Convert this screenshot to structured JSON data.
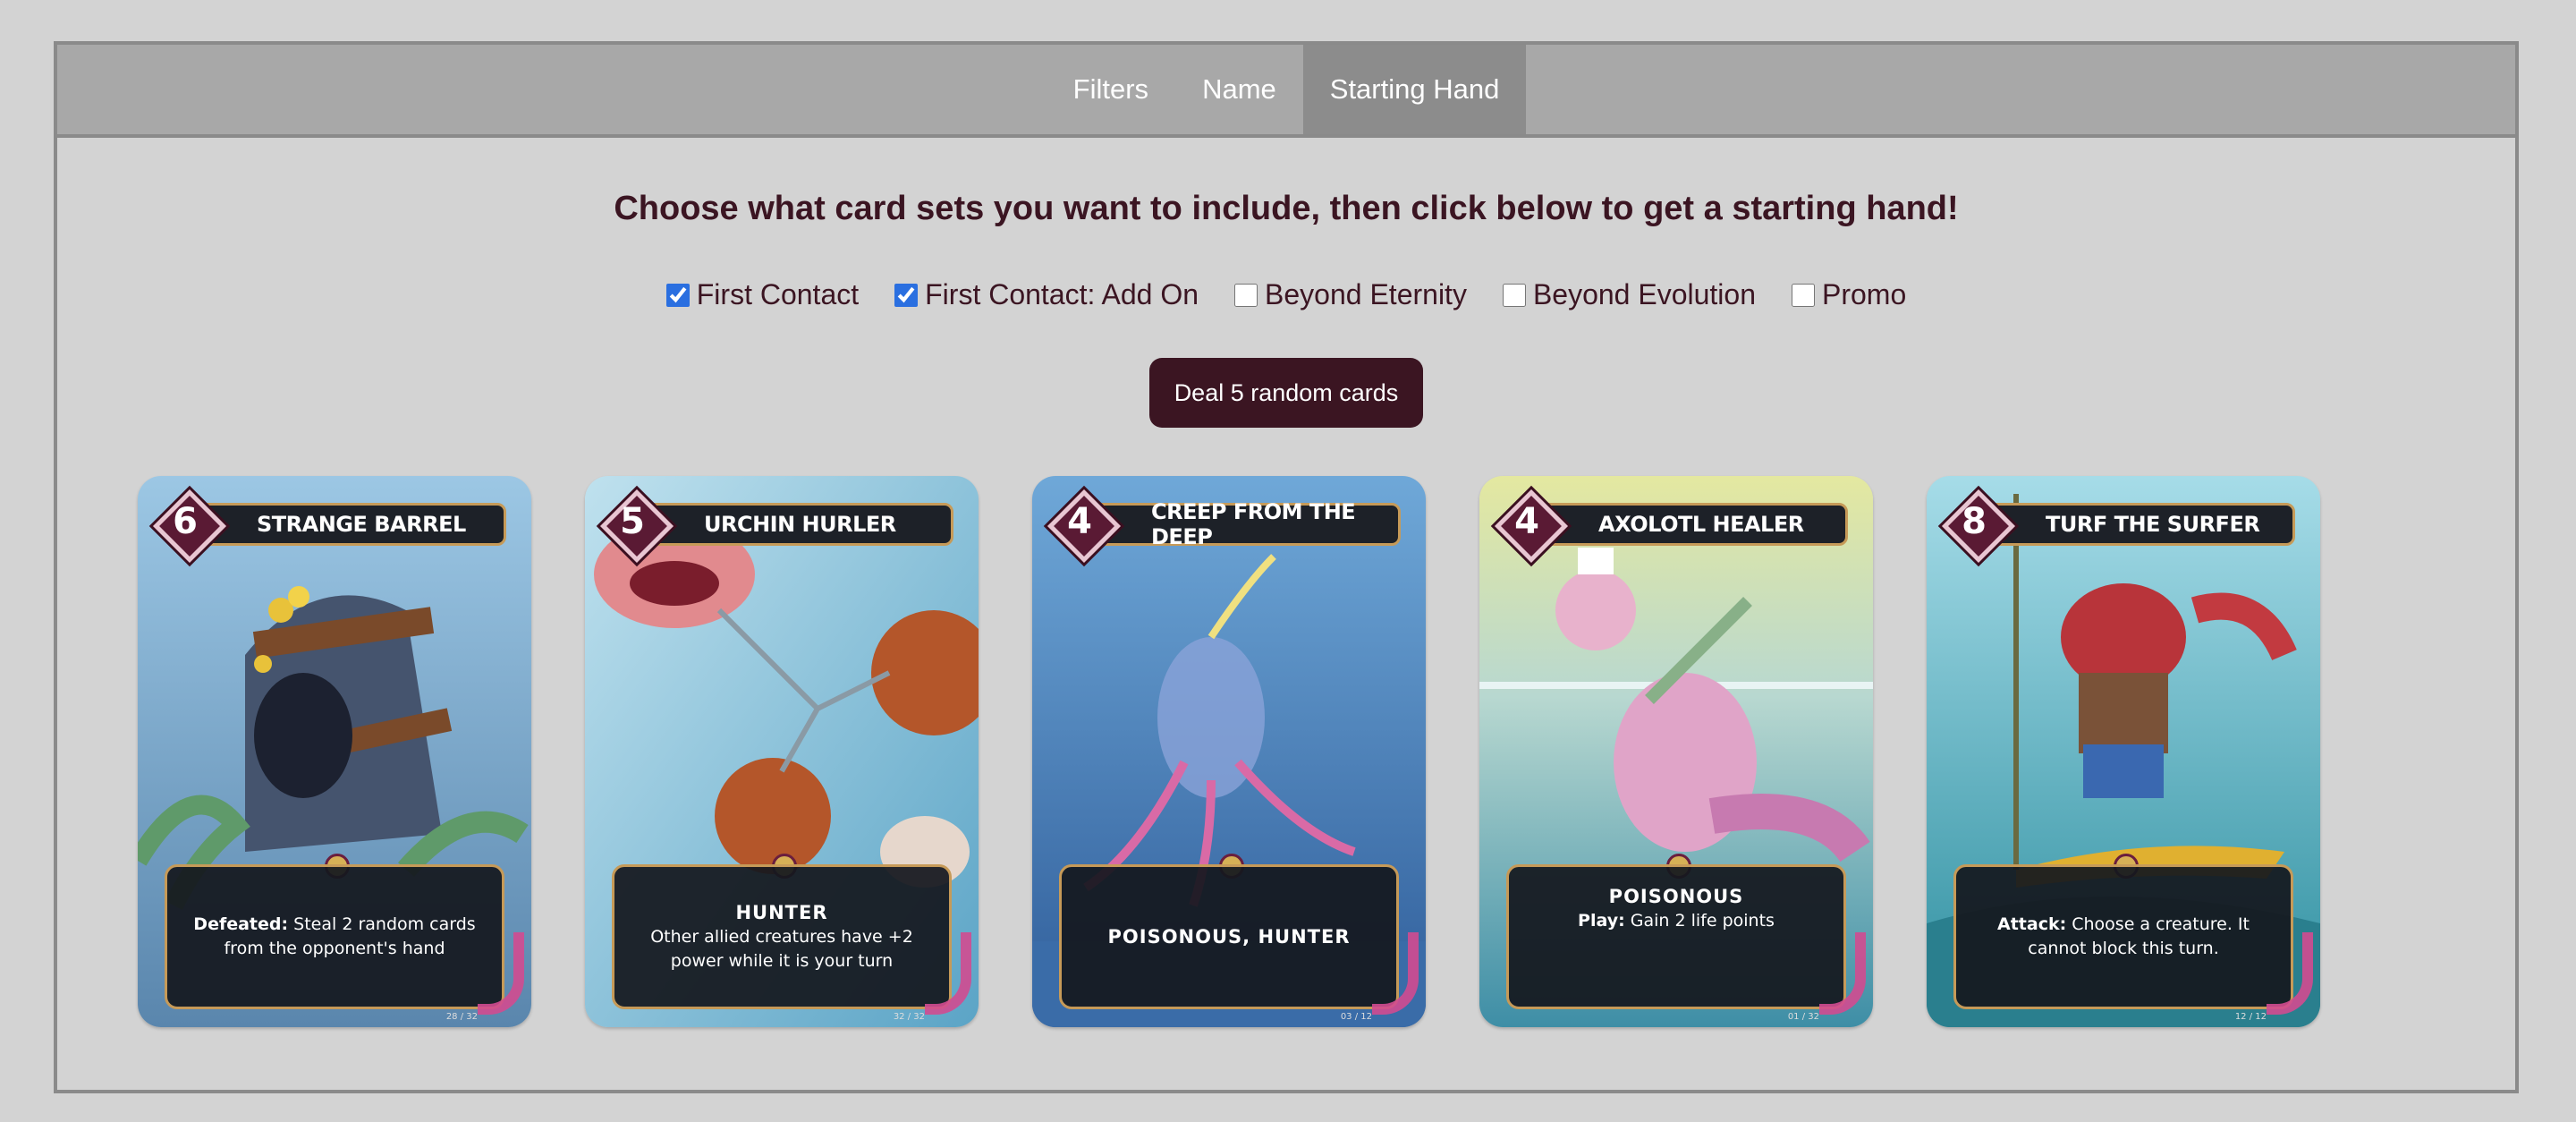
{
  "tabs": [
    {
      "label": "Filters",
      "active": false
    },
    {
      "label": "Name",
      "active": false
    },
    {
      "label": "Starting Hand",
      "active": true
    }
  ],
  "headline": "Choose what card sets you want to include, then click below to get a starting hand!",
  "sets": [
    {
      "label": "First Contact",
      "checked": true
    },
    {
      "label": "First Contact: Add On",
      "checked": true
    },
    {
      "label": "Beyond Eternity",
      "checked": false
    },
    {
      "label": "Beyond Evolution",
      "checked": false
    },
    {
      "label": "Promo",
      "checked": false
    }
  ],
  "deal_button": "Deal 5 random cards",
  "cards": [
    {
      "cost": "6",
      "name": "Strange Barrel",
      "keyword": "",
      "text_bold": "Defeated:",
      "text": "Steal 2 random cards from the opponent's hand",
      "number": "28 / 32"
    },
    {
      "cost": "5",
      "name": "Urchin Hurler",
      "keyword": "HUNTER",
      "text_bold": "",
      "text": "Other allied creatures have +2 power while it is your turn",
      "number": "32 / 32"
    },
    {
      "cost": "4",
      "name": "Creep from the Deep",
      "keyword": "POISONOUS, HUNTER",
      "text_bold": "",
      "text": "",
      "number": "03 / 12"
    },
    {
      "cost": "4",
      "name": "Axolotl Healer",
      "keyword": "POISONOUS",
      "text_bold": "Play:",
      "text": "Gain 2 life points",
      "number": "01 / 32"
    },
    {
      "cost": "8",
      "name": "Turf the Surfer",
      "keyword": "",
      "text_bold": "Attack:",
      "text": "Choose a creature. It cannot block this turn.",
      "number": "12 / 12"
    }
  ]
}
